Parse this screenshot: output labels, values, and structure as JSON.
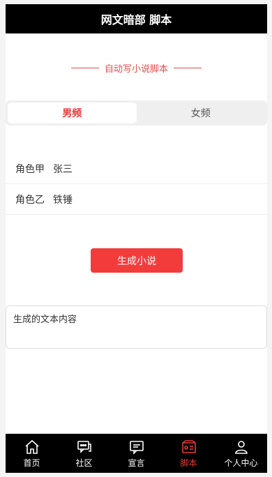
{
  "header": {
    "title": "网文暗部 脚本"
  },
  "section": {
    "subtitle": "自动写小说脚本"
  },
  "tabs": [
    {
      "label": "男频",
      "active": true
    },
    {
      "label": "女频",
      "active": false
    }
  ],
  "roles": [
    {
      "label": "角色甲",
      "value": "张三"
    },
    {
      "label": "角色乙",
      "value": "铁锤"
    }
  ],
  "generate": {
    "label": "生成小说"
  },
  "output": {
    "placeholder": "生成的文本内容"
  },
  "nav": [
    {
      "label": "首页",
      "icon": "home-icon",
      "active": false
    },
    {
      "label": "社区",
      "icon": "chat-icon",
      "active": false
    },
    {
      "label": "宣言",
      "icon": "message-icon",
      "active": false
    },
    {
      "label": "脚本",
      "icon": "script-icon",
      "active": true
    },
    {
      "label": "个人中心",
      "icon": "user-icon",
      "active": false
    }
  ],
  "colors": {
    "accent": "#e8393a",
    "button": "#f23c3c",
    "bar": "#000000"
  }
}
